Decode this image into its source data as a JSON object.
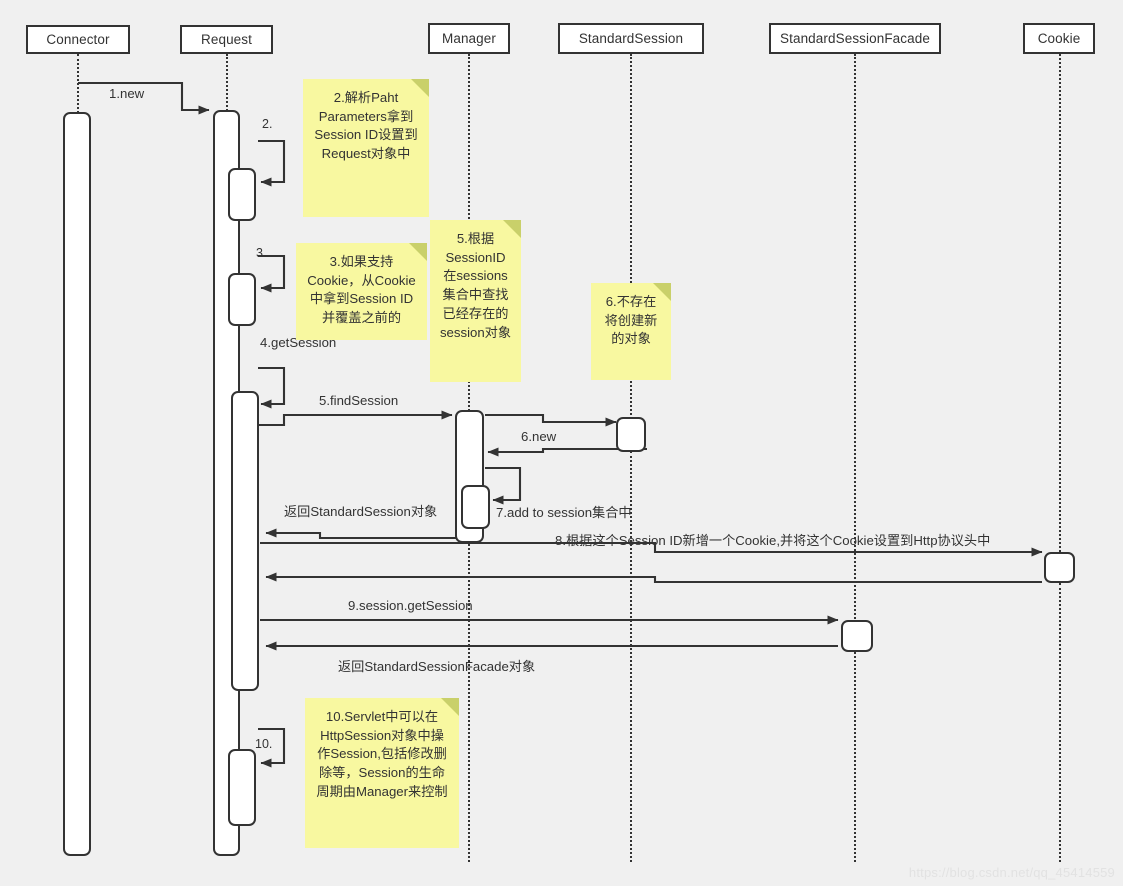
{
  "diagram": {
    "type": "uml-sequence-diagram",
    "background_color": "#f0f0f0",
    "stroke_color": "#333333",
    "note_color": "#f8f8a0",
    "note_fold_color": "#c9d06a",
    "watermark": "https://blog.csdn.net/qq_45414559"
  },
  "lifelines": [
    {
      "id": "connector",
      "label": "Connector"
    },
    {
      "id": "request",
      "label": "Request"
    },
    {
      "id": "manager",
      "label": "Manager"
    },
    {
      "id": "standardsession",
      "label": "StandardSession"
    },
    {
      "id": "standardsessionfacade",
      "label": "StandardSessionFacade"
    },
    {
      "id": "cookie",
      "label": "Cookie"
    }
  ],
  "messages": [
    {
      "id": "m1",
      "label": "1.new",
      "from": "connector",
      "to": "request"
    },
    {
      "id": "m2",
      "label": "2.",
      "from": "request",
      "to": "request"
    },
    {
      "id": "m3",
      "label": "3.",
      "from": "request",
      "to": "request"
    },
    {
      "id": "m4",
      "label": "4.getSession",
      "from": "request",
      "to": "request"
    },
    {
      "id": "m5",
      "label": "5.findSession",
      "from": "request",
      "to": "manager"
    },
    {
      "id": "m6",
      "label": "6.new",
      "from": "manager",
      "to": "standardsession"
    },
    {
      "id": "m7",
      "label": "7.add to session集合中",
      "from": "manager",
      "to": "manager"
    },
    {
      "id": "r1",
      "label": "返回StandardSession对象",
      "from": "manager",
      "to": "request"
    },
    {
      "id": "m8",
      "label": "8.根据这个Session ID新增一个Cookie,并将这个Cookie设置到Http协议头中",
      "from": "request",
      "to": "cookie"
    },
    {
      "id": "m9",
      "label": "9.session.getSession",
      "from": "request",
      "to": "standardsessionfacade"
    },
    {
      "id": "r2",
      "label": "返回StandardSessionFacade对象",
      "from": "standardsessionfacade",
      "to": "request"
    },
    {
      "id": "m10",
      "label": "10.",
      "from": "request",
      "to": "request"
    }
  ],
  "notes": [
    {
      "id": "note2",
      "text": "2.解析Paht\nParameters拿到\nSession ID设置到\nRequest对象中"
    },
    {
      "id": "note3",
      "text": "3.如果支持\nCookie，从Cookie\n中拿到Session ID\n并覆盖之前的"
    },
    {
      "id": "note5",
      "text": "5.根据\nSessionID\n在sessions\n集合中查找\n已经存在的\nsession对象"
    },
    {
      "id": "note6",
      "text": "6.不存在\n将创建新\n的对象"
    },
    {
      "id": "note10",
      "text": "10.Servlet中可以在\nHttpSession对象中操\n作Session,包括修改删\n除等，Session的生命\n周期由Manager来控制"
    }
  ]
}
